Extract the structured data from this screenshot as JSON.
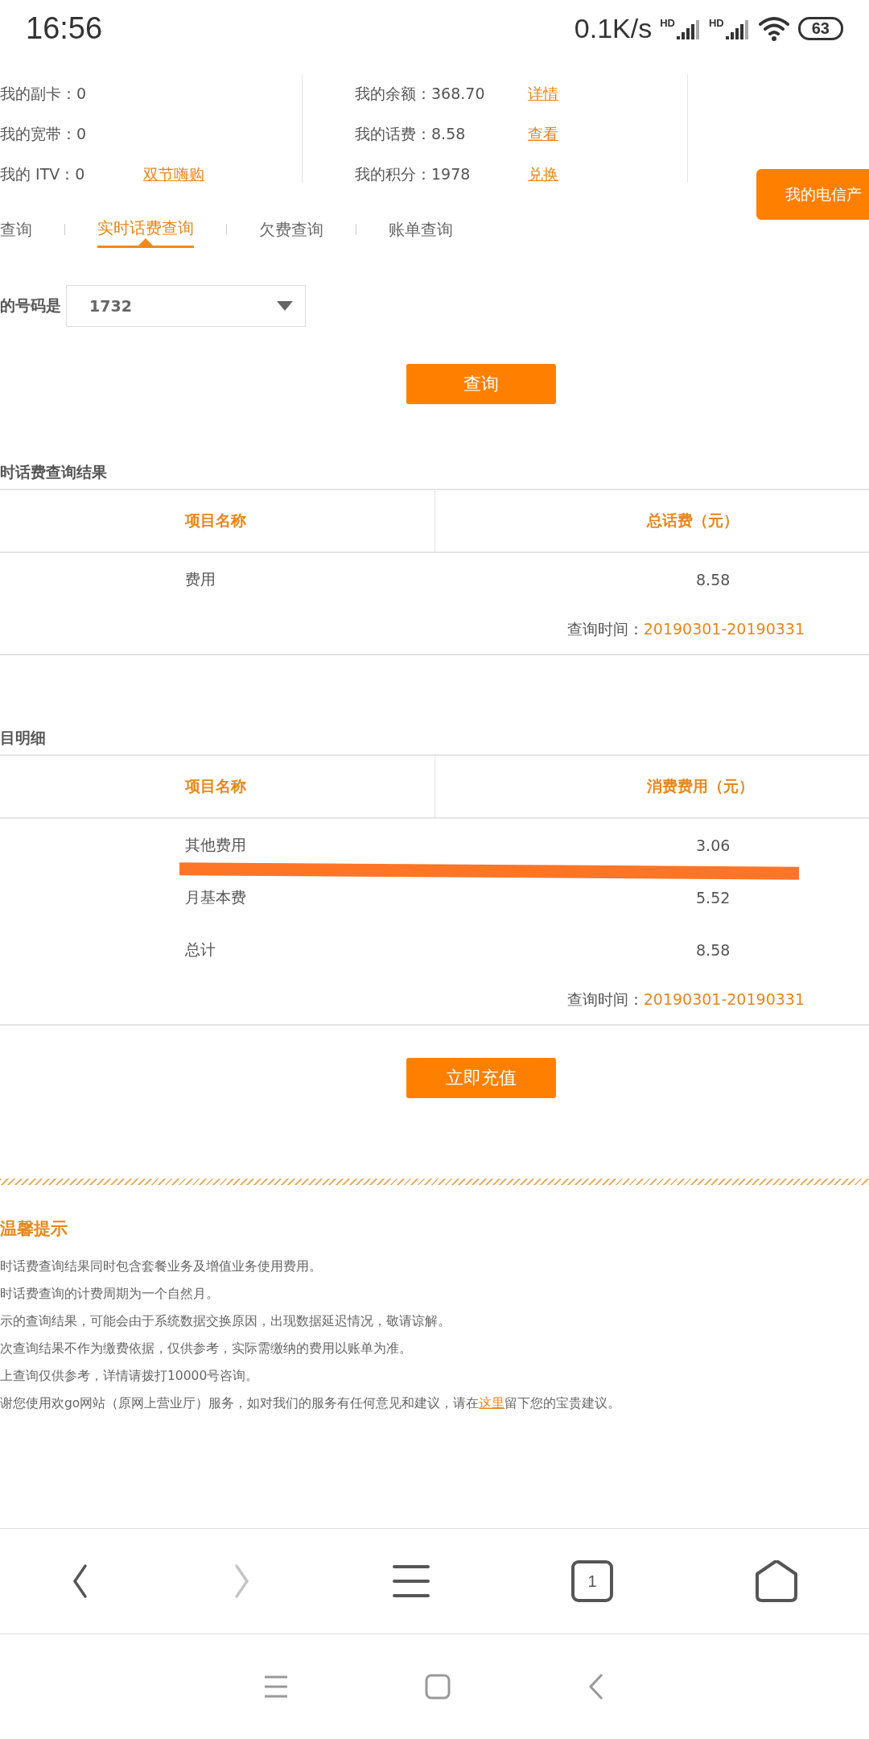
{
  "status_bar": {
    "time": "16:56",
    "speed": "0.1K/s",
    "sim_labels": [
      "HD",
      "HD"
    ],
    "battery": "63"
  },
  "account": {
    "left": [
      {
        "label": "我的副卡：0"
      },
      {
        "label": "我的宽带：0"
      },
      {
        "label": "我的 ITV：0",
        "link": "双节嗨购"
      }
    ],
    "middle": [
      {
        "label": "我的余额：368.70",
        "link": "详情"
      },
      {
        "label": "我的话费：8.58",
        "link": "查看"
      },
      {
        "label": "我的积分：1978",
        "link": "兑换"
      }
    ],
    "product_button": "我的电信产"
  },
  "tabs": [
    {
      "label": "查询",
      "selected": false
    },
    {
      "label": "实时话费查询",
      "selected": true
    },
    {
      "label": "欠费查询",
      "selected": false
    },
    {
      "label": "账单查询",
      "selected": false
    }
  ],
  "number_label": "的号码是",
  "number_value": "1732",
  "query_button": "查询",
  "results": [
    {
      "title": "时话费查询结果",
      "columns": [
        "项目名称",
        "总话费（元）"
      ],
      "rows": [
        [
          "费用",
          "8.58"
        ]
      ],
      "time_label": "查询时间：",
      "time_value": "20190301-20190331"
    },
    {
      "title": "目明细",
      "columns": [
        "项目名称",
        "消费费用（元）"
      ],
      "rows": [
        [
          "其他费用",
          "3.06"
        ],
        [
          "月基本费",
          "5.52"
        ],
        [
          "总计",
          "8.58"
        ]
      ],
      "time_label": "查询时间：",
      "time_value": "20190301-20190331",
      "strike": true
    }
  ],
  "recharge_button": "立即充值",
  "tips": {
    "title": "温馨提示",
    "lines": [
      {
        "text": "时话费查询结果同时包含套餐业务及增值业务使用费用。"
      },
      {
        "text": "时话费查询的计费周期为一个自然月。"
      },
      {
        "text": "示的查询结果，可能会由于系统数据交换原因，出现数据延迟情况，敬请谅解。"
      },
      {
        "text": "次查询结果不作为缴费依据，仅供参考，实际需缴纳的费用以账单为准。"
      },
      {
        "text": "上查询仅供参考，详情请拨打10000号咨询。"
      },
      {
        "text": "谢您使用欢go网站（原网上营业厅）服务，如对我们的服务有任何意见和建议，请在",
        "link": "这里",
        "after": "留下您的宝贵建议。"
      }
    ]
  },
  "browser_nav": [
    {
      "kind": "back",
      "disabled": false
    },
    {
      "kind": "forward",
      "disabled": true
    },
    {
      "kind": "menu",
      "disabled": false
    },
    {
      "kind": "tabs",
      "count": "1",
      "disabled": false
    },
    {
      "kind": "home",
      "disabled": false
    }
  ],
  "system_nav": [
    {
      "kind": "menu"
    },
    {
      "kind": "home"
    },
    {
      "kind": "back"
    }
  ]
}
